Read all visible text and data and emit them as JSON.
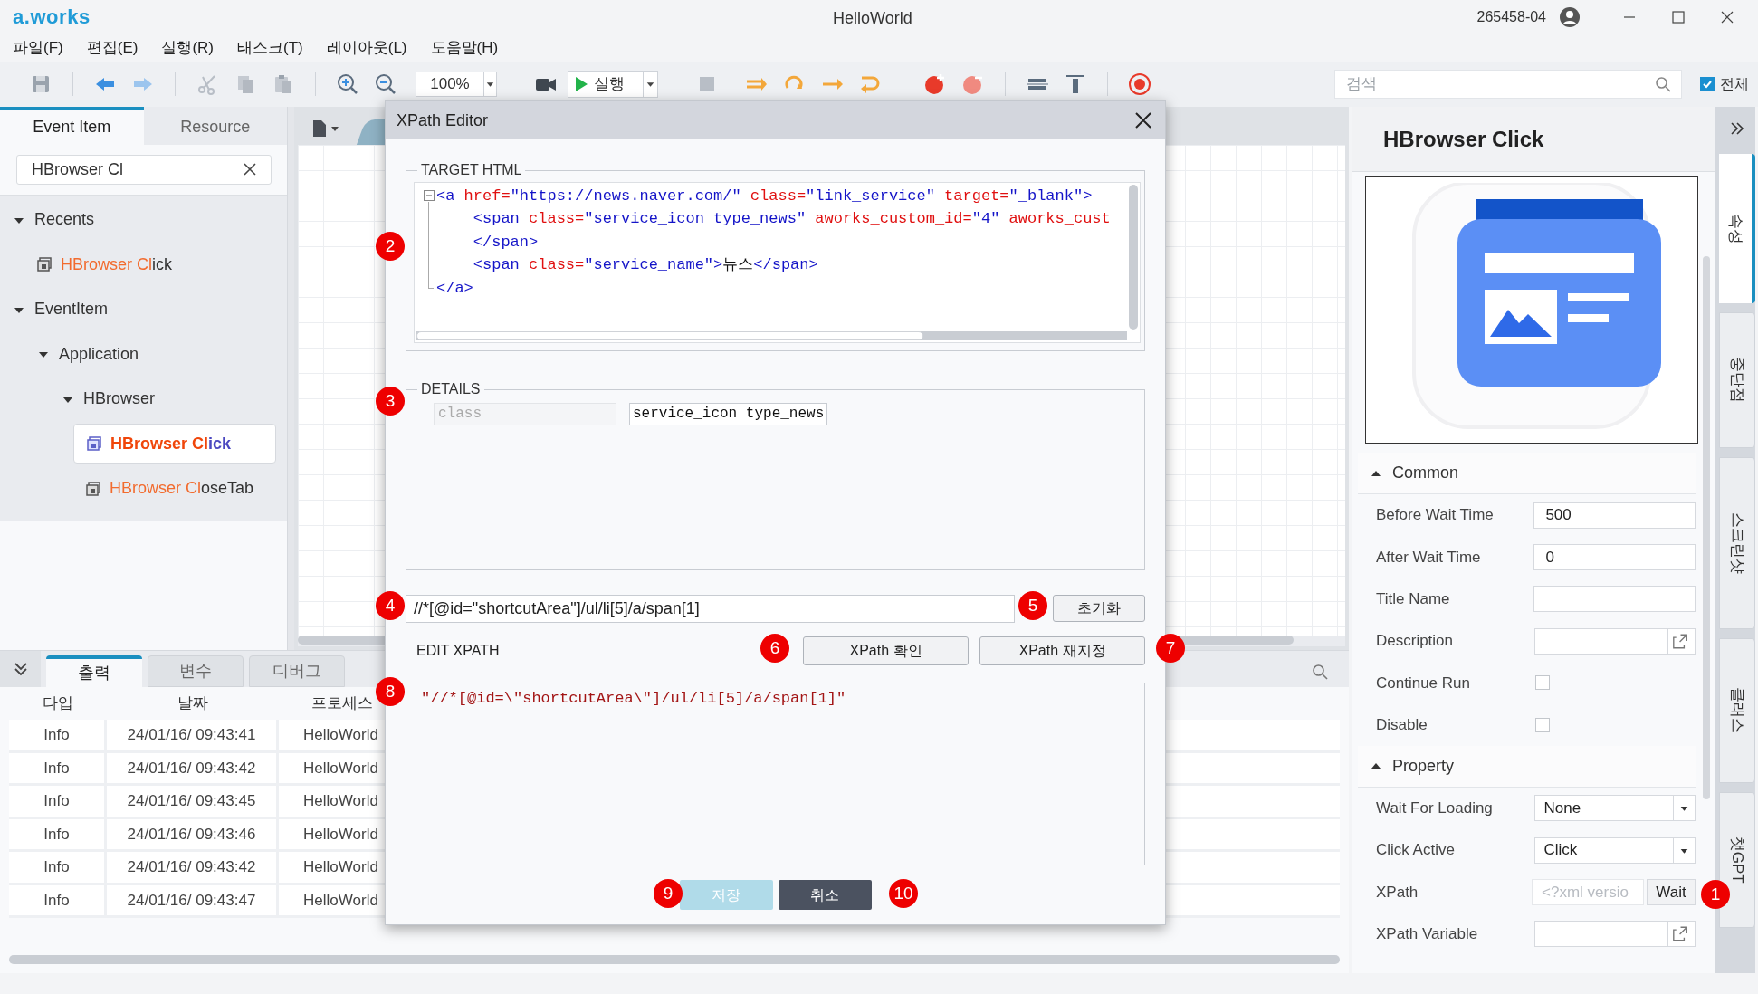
{
  "title_bar": {
    "logo": "a.works",
    "title": "HelloWorld",
    "user": "265458-04"
  },
  "menu": [
    "파일(F)",
    "편집(E)",
    "실행(R)",
    "태스크(T)",
    "레이아웃(L)",
    "도움말(H)"
  ],
  "toolbar": {
    "zoom": "100%",
    "run_label": "실행",
    "search": {
      "placeholder": "검색"
    },
    "scope": {
      "label": "전체",
      "checked": true
    }
  },
  "left_panel": {
    "tabs": [
      {
        "label": "Event Item",
        "selected": true
      },
      {
        "label": "Resource",
        "selected": false
      }
    ],
    "search": {
      "value": "HBrowser Cl"
    },
    "tree": [
      {
        "kind": "group",
        "label": "Recents",
        "expanded": true,
        "children": [
          {
            "kind": "item",
            "match": "HBrowser Cl",
            "rest": "ick",
            "selected": false
          }
        ]
      },
      {
        "kind": "group",
        "label": "EventItem",
        "expanded": true,
        "children": [
          {
            "kind": "group",
            "label": "Application",
            "expanded": true,
            "children": [
              {
                "kind": "group",
                "label": "HBrowser",
                "expanded": true,
                "children": [
                  {
                    "kind": "item",
                    "match": "HBrowser Cl",
                    "rest": "ick",
                    "selected": true
                  },
                  {
                    "kind": "item",
                    "match": "HBrowser Cl",
                    "rest": "oseTab",
                    "selected": false
                  }
                ]
              }
            ]
          }
        ]
      }
    ]
  },
  "output_panel": {
    "tabs": [
      {
        "label": "출력",
        "selected": true
      },
      {
        "label": "변수",
        "selected": false
      },
      {
        "label": "디버그",
        "selected": false
      }
    ],
    "columns": [
      "타입",
      "날짜",
      "프로세스"
    ],
    "rows": [
      [
        "Info",
        "24/01/16/ 09:43:41",
        "HelloWorld"
      ],
      [
        "Info",
        "24/01/16/ 09:43:42",
        "HelloWorld"
      ],
      [
        "Info",
        "24/01/16/ 09:43:45",
        "HelloWorld"
      ],
      [
        "Info",
        "24/01/16/ 09:43:46",
        "HelloWorld"
      ],
      [
        "Info",
        "24/01/16/ 09:43:42",
        "HelloWorld"
      ],
      [
        "Info",
        "24/01/16/ 09:43:47",
        "HelloWorld"
      ]
    ]
  },
  "xpath_editor": {
    "title": "XPath Editor",
    "target_html": {
      "legend": "TARGET HTML",
      "lines": [
        [
          {
            "kind": "tag",
            "text": "<a"
          },
          {
            "kind": "attr",
            "text": " href="
          },
          {
            "kind": "value",
            "text": "\"https://news.naver.com/\""
          },
          {
            "kind": "attr",
            "text": " class="
          },
          {
            "kind": "value",
            "text": "\"link_service\""
          },
          {
            "kind": "attr",
            "text": " target="
          },
          {
            "kind": "value",
            "text": "\"_blank\""
          },
          {
            "kind": "tag",
            "text": ">"
          }
        ],
        [
          {
            "kind": "tag",
            "text": "    <span"
          },
          {
            "kind": "attr",
            "text": " class="
          },
          {
            "kind": "value",
            "text": "\"service_icon type_news\""
          },
          {
            "kind": "attr",
            "text": " aworks_custom_id="
          },
          {
            "kind": "value",
            "text": "\"4\""
          },
          {
            "kind": "attr",
            "text": " aworks_cust"
          }
        ],
        [
          {
            "kind": "tag",
            "text": "    </span>"
          }
        ],
        [
          {
            "kind": "tag",
            "text": "    <span"
          },
          {
            "kind": "attr",
            "text": " class="
          },
          {
            "kind": "value",
            "text": "\"service_name\""
          },
          {
            "kind": "tag",
            "text": ">"
          },
          {
            "kind": "text",
            "text": "뉴스"
          },
          {
            "kind": "tag",
            "text": "</span>"
          }
        ],
        [
          {
            "kind": "tag",
            "text": "</a>"
          }
        ]
      ]
    },
    "details": {
      "legend": "DETAILS",
      "rows": [
        {
          "name": "class",
          "value": "service_icon type_news"
        }
      ]
    },
    "xpath": {
      "value": "//*[@id=\"shortcutArea\"]/ul/li[5]/a/span[1]"
    },
    "reset_button": "초기화",
    "edit_label": "EDIT XPATH",
    "check_button": "XPath 확인",
    "reassign_button": "XPath 재지정",
    "edit_code": "\"//*[@id=\\\"shortcutArea\\\"]/ul/li[5]/a/span[1]\"",
    "buttons": [
      {
        "label": "저장",
        "kind": "primary",
        "disabled": true
      },
      {
        "label": "취소",
        "kind": "secondary",
        "disabled": false
      }
    ]
  },
  "properties": {
    "title": "HBrowser Click",
    "sections": [
      {
        "label": "Common",
        "expanded": true,
        "rows": [
          {
            "kind": "text",
            "label": "Before Wait Time",
            "value": "500"
          },
          {
            "kind": "text",
            "label": "After Wait Time",
            "value": "0"
          },
          {
            "kind": "text",
            "label": "Title Name"
          },
          {
            "kind": "link",
            "label": "Description"
          },
          {
            "kind": "check",
            "label": "Continue Run",
            "checked": false
          },
          {
            "kind": "check",
            "label": "Disable",
            "checked": false
          }
        ]
      },
      {
        "label": "Property",
        "expanded": true,
        "rows": [
          {
            "kind": "select",
            "label": "Wait For Loading",
            "value": "None"
          },
          {
            "kind": "select",
            "label": "Click Active",
            "value": "Click"
          },
          {
            "kind": "xpath",
            "label": "XPath",
            "placeholder": "<?xml versio",
            "button": "Wait"
          },
          {
            "kind": "link",
            "label": "XPath Variable"
          }
        ]
      }
    ]
  },
  "side_tabs": [
    {
      "label": "속성",
      "selected": true
    },
    {
      "label": "중단점",
      "selected": false
    },
    {
      "label": "스크린샷",
      "selected": false
    },
    {
      "label": "클래스",
      "selected": false
    },
    {
      "label": "챗GPT",
      "selected": false
    }
  ],
  "callouts": [
    "1",
    "2",
    "3",
    "4",
    "5",
    "6",
    "7",
    "8",
    "9",
    "10"
  ]
}
